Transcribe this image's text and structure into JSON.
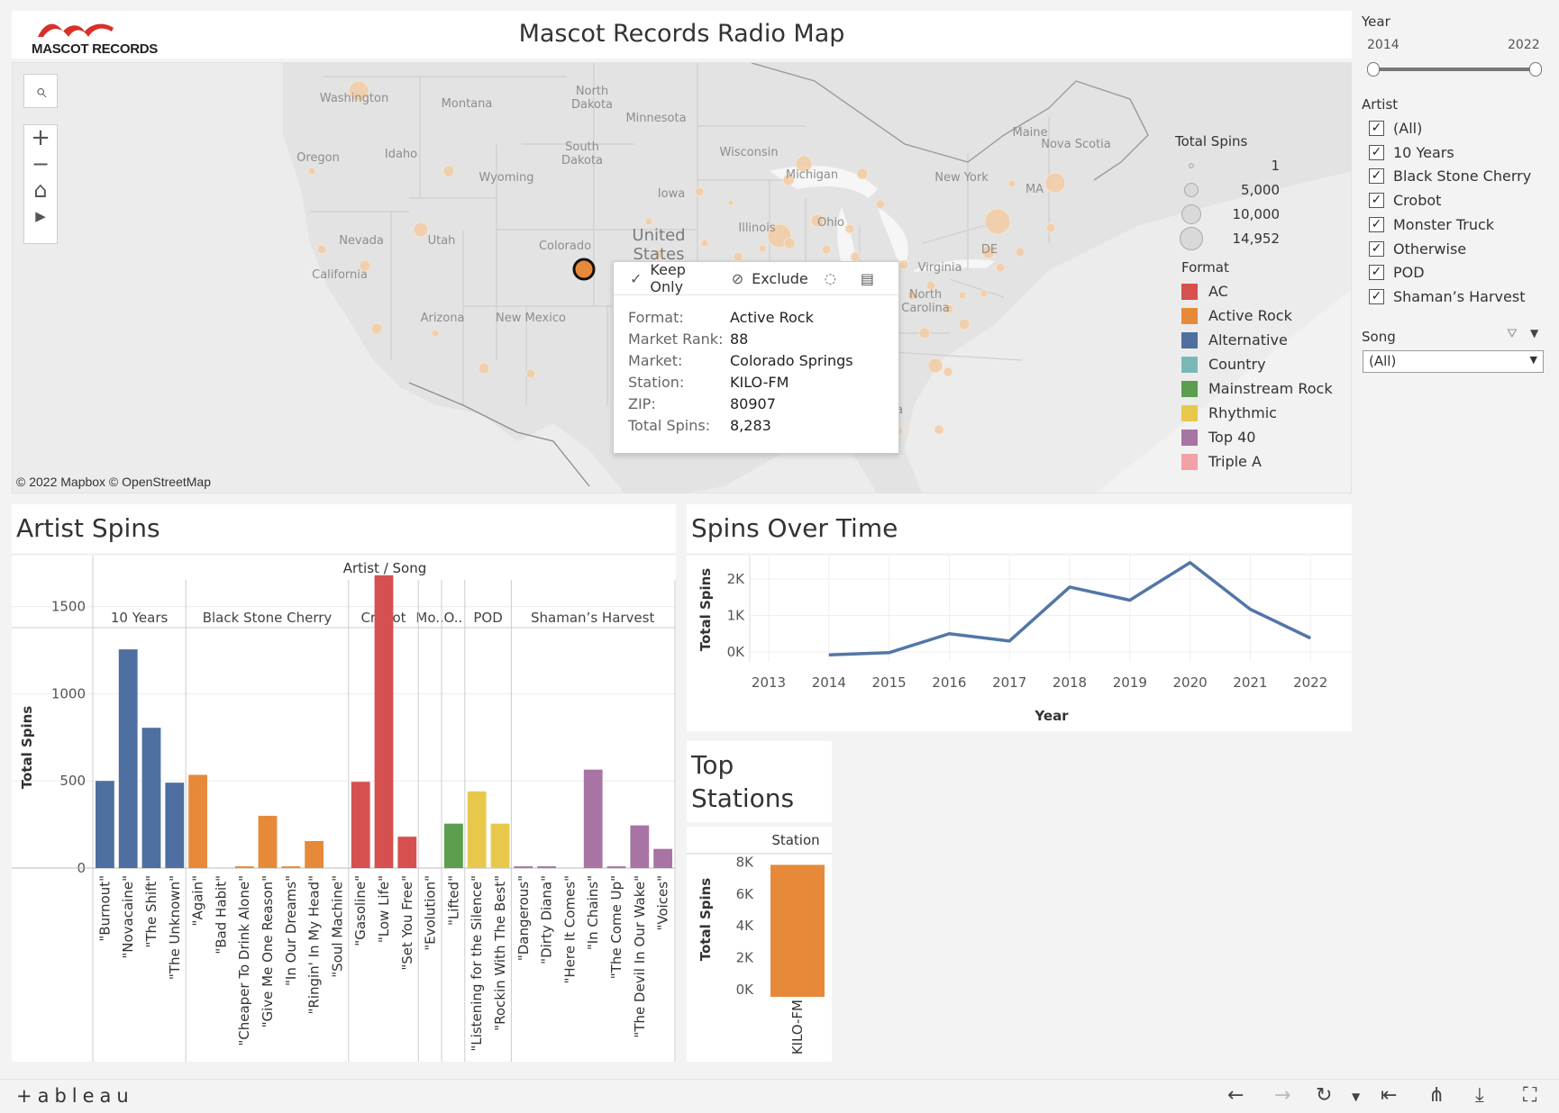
{
  "header": {
    "logo_text": "MASCOT RECORDS",
    "title": "Mascot Records Radio Map"
  },
  "map": {
    "attribution": "© 2022 Mapbox  © OpenStreetMap",
    "state_labels": [
      "Washington",
      "Montana",
      "North\nDakota",
      "Minnesota",
      "Oregon",
      "Idaho",
      "South\nDakota",
      "Wisconsin",
      "Michigan",
      "Maine",
      "Nova Scotia",
      "Wyoming",
      "Iowa",
      "New York",
      "MA",
      "Nevada",
      "Utah",
      "Colorado",
      "Illinois",
      "Ohio",
      "California",
      "DE",
      "Virginia",
      "Arizona",
      "New Mexico",
      "North\nCarolina",
      "da"
    ],
    "country_label": "United\nStates",
    "tools": {
      "search": "⌕",
      "zoom_in": "+",
      "zoom_out": "−",
      "home": "⌂",
      "play": "▶"
    }
  },
  "legend_spins": {
    "title": "Total Spins",
    "items": [
      "1",
      "5,000",
      "10,000",
      "14,952"
    ]
  },
  "legend_format": {
    "title": "Format",
    "items": [
      {
        "label": "AC",
        "color": "#d5504f"
      },
      {
        "label": "Active Rock",
        "color": "#e68a3a"
      },
      {
        "label": "Alternative",
        "color": "#4e6fa0"
      },
      {
        "label": "Country",
        "color": "#7ab8b7"
      },
      {
        "label": "Mainstream Rock",
        "color": "#5b9e4d"
      },
      {
        "label": "Rhythmic",
        "color": "#e8c84b"
      },
      {
        "label": "Top 40",
        "color": "#a874a3"
      },
      {
        "label": "Triple A",
        "color": "#f3a0a7"
      }
    ]
  },
  "tooltip": {
    "keep_only": "Keep Only",
    "exclude": "Exclude",
    "rows": [
      {
        "key": "Format:",
        "value": "Active Rock"
      },
      {
        "key": "Market Rank:",
        "value": "88"
      },
      {
        "key": "Market:",
        "value": "Colorado Springs"
      },
      {
        "key": "Station:",
        "value": "KILO-FM"
      },
      {
        "key": "ZIP:",
        "value": "80907"
      },
      {
        "key": "Total Spins:",
        "value": "8,283"
      }
    ]
  },
  "filters": {
    "year": {
      "label": "Year",
      "min": "2014",
      "max": "2022"
    },
    "artist": {
      "label": "Artist",
      "items": [
        "(All)",
        "10 Years",
        "Black Stone Cherry",
        "Crobot",
        "Monster Truck",
        "Otherwise",
        "POD",
        "Shaman’s Harvest"
      ]
    },
    "song": {
      "label": "Song",
      "value": "(All)"
    }
  },
  "panels": {
    "artist_spins_title": "Artist Spins",
    "spins_over_time_title": "Spins Over Time",
    "top_stations_title": "Top\nStations"
  },
  "chart_data": [
    {
      "type": "bar",
      "title": "Artist Spins",
      "header": "Artist / Song",
      "ylabel": "Total Spins",
      "ylim": [
        0,
        1700
      ],
      "yticks": [
        0,
        500,
        1000,
        1500
      ],
      "groups": [
        {
          "artist": "10 Years",
          "songs": [
            {
              "name": "\"Burnout\"",
              "value": 500,
              "format": "Alternative"
            },
            {
              "name": "\"Novacaine\"",
              "value": 1255,
              "format": "Alternative"
            },
            {
              "name": "\"The Shift\"",
              "value": 805,
              "format": "Alternative"
            },
            {
              "name": "\"The Unknown\"",
              "value": 490,
              "format": "Alternative"
            }
          ]
        },
        {
          "artist": "Black Stone Cherry",
          "songs": [
            {
              "name": "\"Again\"",
              "value": 535,
              "format": "Active Rock"
            },
            {
              "name": "\"Bad Habit\"",
              "value": 0,
              "format": "Active Rock"
            },
            {
              "name": "\"Cheaper To Drink Alone\"",
              "value": 10,
              "format": "Active Rock"
            },
            {
              "name": "\"Give Me One Reason\"",
              "value": 300,
              "format": "Active Rock"
            },
            {
              "name": "\"In Our Dreams\"",
              "value": 10,
              "format": "Active Rock"
            },
            {
              "name": "\"Ringin' In My Head\"",
              "value": 155,
              "format": "Active Rock"
            },
            {
              "name": "\"Soul Machine\"",
              "value": 0,
              "format": "Active Rock"
            }
          ]
        },
        {
          "artist": "Crobot",
          "songs": [
            {
              "name": "\"Gasoline\"",
              "value": 495,
              "format": "AC"
            },
            {
              "name": "\"Low Life\"",
              "value": 1680,
              "format": "AC"
            },
            {
              "name": "\"Set You Free\"",
              "value": 180,
              "format": "AC"
            }
          ]
        },
        {
          "artist": "Mo..",
          "songs": [
            {
              "name": "\"Evolution\"",
              "value": 0,
              "format": "AC"
            }
          ]
        },
        {
          "artist": "O..",
          "songs": [
            {
              "name": "\"Lifted\"",
              "value": 255,
              "format": "Mainstream Rock"
            }
          ]
        },
        {
          "artist": "POD",
          "songs": [
            {
              "name": "\"Listening for the Silence\"",
              "value": 440,
              "format": "Rhythmic"
            },
            {
              "name": "\"Rockin With The Best\"",
              "value": 255,
              "format": "Rhythmic"
            }
          ]
        },
        {
          "artist": "Shaman’s Harvest",
          "songs": [
            {
              "name": "\"Dangerous\"",
              "value": 10,
              "format": "Top 40"
            },
            {
              "name": "\"Dirty Diana\"",
              "value": 10,
              "format": "Top 40"
            },
            {
              "name": "\"Here It Comes\"",
              "value": 0,
              "format": "Top 40"
            },
            {
              "name": "\"In Chains\"",
              "value": 565,
              "format": "Top 40"
            },
            {
              "name": "\"The Come Up\"",
              "value": 10,
              "format": "Top 40"
            },
            {
              "name": "\"The Devil In Our Wake\"",
              "value": 245,
              "format": "Top 40"
            },
            {
              "name": "\"Voices\"",
              "value": 110,
              "format": "Top 40"
            }
          ]
        }
      ]
    },
    {
      "type": "line",
      "title": "Spins Over Time",
      "xlabel": "Year",
      "ylabel": "Total Spins",
      "x": [
        2014,
        2015,
        2016,
        2017,
        2018,
        2019,
        2020,
        2021,
        2022
      ],
      "values": [
        -80,
        -20,
        500,
        300,
        1780,
        1420,
        2450,
        1170,
        380
      ],
      "xticks": [
        "2013",
        "2014",
        "2015",
        "2016",
        "2017",
        "2018",
        "2019",
        "2020",
        "2021",
        "2022",
        "2023"
      ],
      "yticks": [
        "0K",
        "1K",
        "2K"
      ],
      "ylim": [
        -300,
        2800
      ],
      "color": "#5276a6"
    },
    {
      "type": "bar",
      "title": "Top Stations",
      "header": "Station",
      "ylabel": "Total Spins",
      "categories": [
        "KILO-FM"
      ],
      "values": [
        8283
      ],
      "yticks": [
        "0K",
        "2K",
        "4K",
        "6K",
        "8K"
      ],
      "ylim": [
        0,
        8500
      ],
      "color": "#e68a3a"
    }
  ],
  "footer": {
    "brand": "+ableau"
  }
}
